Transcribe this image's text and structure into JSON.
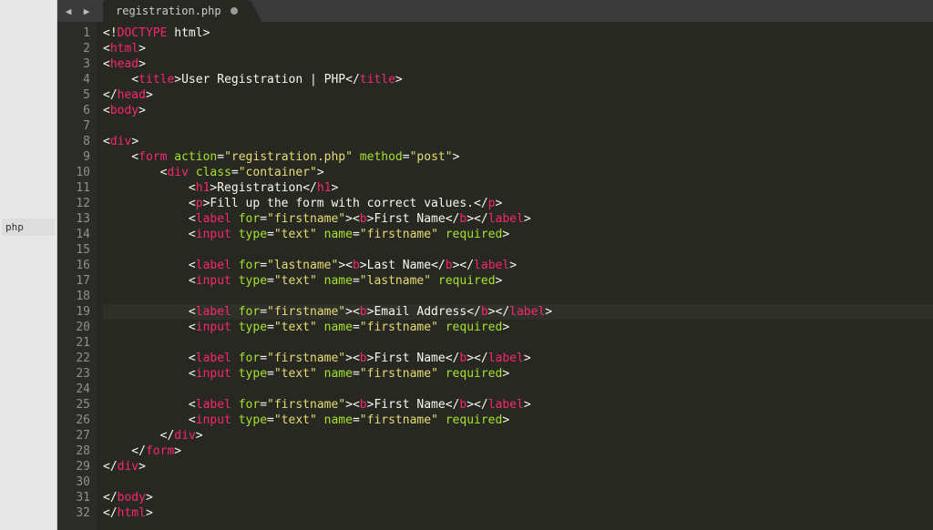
{
  "sidebar": {
    "file_label": "php"
  },
  "titlebar": {
    "back_icon": "◀",
    "forward_icon": "▶"
  },
  "tab": {
    "filename": "registration.php",
    "dirty": true
  },
  "gutter": {
    "start": 1,
    "end": 32
  },
  "code": {
    "lines": [
      [
        [
          "p",
          "<!"
        ],
        [
          "doctype",
          "DOCTYPE"
        ],
        [
          "p",
          " html>"
        ]
      ],
      [
        [
          "p",
          "<"
        ],
        [
          "tag",
          "html"
        ],
        [
          "p",
          ">"
        ]
      ],
      [
        [
          "p",
          "<"
        ],
        [
          "tag",
          "head"
        ],
        [
          "p",
          ">"
        ]
      ],
      [
        [
          "p",
          "    <"
        ],
        [
          "tag",
          "title"
        ],
        [
          "p",
          ">"
        ],
        [
          "txt",
          "User Registration | PHP"
        ],
        [
          "p",
          "</"
        ],
        [
          "tag",
          "title"
        ],
        [
          "p",
          ">"
        ]
      ],
      [
        [
          "p",
          "</"
        ],
        [
          "tag",
          "head"
        ],
        [
          "p",
          ">"
        ]
      ],
      [
        [
          "p",
          "<"
        ],
        [
          "tag",
          "body"
        ],
        [
          "p",
          ">"
        ]
      ],
      [],
      [
        [
          "p",
          "<"
        ],
        [
          "tag",
          "div"
        ],
        [
          "p",
          ">"
        ]
      ],
      [
        [
          "p",
          "    <"
        ],
        [
          "tag",
          "form"
        ],
        [
          "p",
          " "
        ],
        [
          "attr",
          "action"
        ],
        [
          "p",
          "="
        ],
        [
          "str",
          "\"registration.php\""
        ],
        [
          "p",
          " "
        ],
        [
          "attr",
          "method"
        ],
        [
          "p",
          "="
        ],
        [
          "str",
          "\"post\""
        ],
        [
          "p",
          ">"
        ]
      ],
      [
        [
          "p",
          "        <"
        ],
        [
          "tag",
          "div"
        ],
        [
          "p",
          " "
        ],
        [
          "attr",
          "class"
        ],
        [
          "p",
          "="
        ],
        [
          "str",
          "\"container\""
        ],
        [
          "p",
          ">"
        ]
      ],
      [
        [
          "p",
          "            <"
        ],
        [
          "tag",
          "h1"
        ],
        [
          "p",
          ">"
        ],
        [
          "txt",
          "Registration"
        ],
        [
          "p",
          "</"
        ],
        [
          "tag",
          "h1"
        ],
        [
          "p",
          ">"
        ]
      ],
      [
        [
          "p",
          "            <"
        ],
        [
          "tag",
          "p"
        ],
        [
          "p",
          ">"
        ],
        [
          "txt",
          "Fill up the form with correct values."
        ],
        [
          "p",
          "</"
        ],
        [
          "tag",
          "p"
        ],
        [
          "p",
          ">"
        ]
      ],
      [
        [
          "p",
          "            <"
        ],
        [
          "tag",
          "label"
        ],
        [
          "p",
          " "
        ],
        [
          "attr",
          "for"
        ],
        [
          "p",
          "="
        ],
        [
          "str",
          "\"firstname\""
        ],
        [
          "p",
          "><"
        ],
        [
          "tag",
          "b"
        ],
        [
          "p",
          ">"
        ],
        [
          "txt",
          "First Name"
        ],
        [
          "p",
          "</"
        ],
        [
          "tag",
          "b"
        ],
        [
          "p",
          "></"
        ],
        [
          "tag",
          "label"
        ],
        [
          "p",
          ">"
        ]
      ],
      [
        [
          "p",
          "            <"
        ],
        [
          "tag",
          "input"
        ],
        [
          "p",
          " "
        ],
        [
          "attr",
          "type"
        ],
        [
          "p",
          "="
        ],
        [
          "str",
          "\"text\""
        ],
        [
          "p",
          " "
        ],
        [
          "attr",
          "name"
        ],
        [
          "p",
          "="
        ],
        [
          "str",
          "\"firstname\""
        ],
        [
          "p",
          " "
        ],
        [
          "attr",
          "required"
        ],
        [
          "p",
          ">"
        ]
      ],
      [],
      [
        [
          "p",
          "            <"
        ],
        [
          "tag",
          "label"
        ],
        [
          "p",
          " "
        ],
        [
          "attr",
          "for"
        ],
        [
          "p",
          "="
        ],
        [
          "str",
          "\"lastname\""
        ],
        [
          "p",
          "><"
        ],
        [
          "tag",
          "b"
        ],
        [
          "p",
          ">"
        ],
        [
          "txt",
          "Last Name"
        ],
        [
          "p",
          "</"
        ],
        [
          "tag",
          "b"
        ],
        [
          "p",
          "></"
        ],
        [
          "tag",
          "label"
        ],
        [
          "p",
          ">"
        ]
      ],
      [
        [
          "p",
          "            <"
        ],
        [
          "tag",
          "input"
        ],
        [
          "p",
          " "
        ],
        [
          "attr",
          "type"
        ],
        [
          "p",
          "="
        ],
        [
          "str",
          "\"text\""
        ],
        [
          "p",
          " "
        ],
        [
          "attr",
          "name"
        ],
        [
          "p",
          "="
        ],
        [
          "str",
          "\"lastname\""
        ],
        [
          "p",
          " "
        ],
        [
          "attr",
          "required"
        ],
        [
          "p",
          ">"
        ]
      ],
      [],
      [
        [
          "p",
          "            <"
        ],
        [
          "tag",
          "label"
        ],
        [
          "p",
          " "
        ],
        [
          "attr",
          "for"
        ],
        [
          "p",
          "="
        ],
        [
          "str",
          "\"firstname\""
        ],
        [
          "p",
          "><"
        ],
        [
          "tag",
          "b"
        ],
        [
          "p",
          ">"
        ],
        [
          "txt",
          "Email Address"
        ],
        [
          "p",
          "</"
        ],
        [
          "tag",
          "b"
        ],
        [
          "p",
          "></"
        ],
        [
          "tag",
          "label"
        ],
        [
          "p",
          ">"
        ]
      ],
      [
        [
          "p",
          "            <"
        ],
        [
          "tag",
          "input"
        ],
        [
          "p",
          " "
        ],
        [
          "attr",
          "type"
        ],
        [
          "p",
          "="
        ],
        [
          "str",
          "\"text\""
        ],
        [
          "p",
          " "
        ],
        [
          "attr",
          "name"
        ],
        [
          "p",
          "="
        ],
        [
          "str",
          "\"firstname\""
        ],
        [
          "p",
          " "
        ],
        [
          "attr",
          "required"
        ],
        [
          "p",
          ">"
        ]
      ],
      [],
      [
        [
          "p",
          "            <"
        ],
        [
          "tag",
          "label"
        ],
        [
          "p",
          " "
        ],
        [
          "attr",
          "for"
        ],
        [
          "p",
          "="
        ],
        [
          "str",
          "\"firstname\""
        ],
        [
          "p",
          "><"
        ],
        [
          "tag",
          "b"
        ],
        [
          "p",
          ">"
        ],
        [
          "txt",
          "First Name"
        ],
        [
          "p",
          "</"
        ],
        [
          "tag",
          "b"
        ],
        [
          "p",
          "></"
        ],
        [
          "tag",
          "label"
        ],
        [
          "p",
          ">"
        ]
      ],
      [
        [
          "p",
          "            <"
        ],
        [
          "tag",
          "input"
        ],
        [
          "p",
          " "
        ],
        [
          "attr",
          "type"
        ],
        [
          "p",
          "="
        ],
        [
          "str",
          "\"text\""
        ],
        [
          "p",
          " "
        ],
        [
          "attr",
          "name"
        ],
        [
          "p",
          "="
        ],
        [
          "str",
          "\"firstname\""
        ],
        [
          "p",
          " "
        ],
        [
          "attr",
          "required"
        ],
        [
          "p",
          ">"
        ]
      ],
      [],
      [
        [
          "p",
          "            <"
        ],
        [
          "tag",
          "label"
        ],
        [
          "p",
          " "
        ],
        [
          "attr",
          "for"
        ],
        [
          "p",
          "="
        ],
        [
          "str",
          "\"firstname\""
        ],
        [
          "p",
          "><"
        ],
        [
          "tag",
          "b"
        ],
        [
          "p",
          ">"
        ],
        [
          "txt",
          "First Name"
        ],
        [
          "p",
          "</"
        ],
        [
          "tag",
          "b"
        ],
        [
          "p",
          "></"
        ],
        [
          "tag",
          "label"
        ],
        [
          "p",
          ">"
        ]
      ],
      [
        [
          "p",
          "            <"
        ],
        [
          "tag",
          "input"
        ],
        [
          "p",
          " "
        ],
        [
          "attr",
          "type"
        ],
        [
          "p",
          "="
        ],
        [
          "str",
          "\"text\""
        ],
        [
          "p",
          " "
        ],
        [
          "attr",
          "name"
        ],
        [
          "p",
          "="
        ],
        [
          "str",
          "\"firstname\""
        ],
        [
          "p",
          " "
        ],
        [
          "attr",
          "required"
        ],
        [
          "p",
          ">"
        ]
      ],
      [
        [
          "p",
          "        </"
        ],
        [
          "tag",
          "div"
        ],
        [
          "p",
          ">"
        ]
      ],
      [
        [
          "p",
          "    </"
        ],
        [
          "tag",
          "form"
        ],
        [
          "p",
          ">"
        ]
      ],
      [
        [
          "p",
          "</"
        ],
        [
          "tag",
          "div"
        ],
        [
          "p",
          ">"
        ]
      ],
      [],
      [
        [
          "p",
          "</"
        ],
        [
          "tag",
          "body"
        ],
        [
          "p",
          ">"
        ]
      ],
      [
        [
          "p",
          "</"
        ],
        [
          "tag",
          "html"
        ],
        [
          "p",
          ">"
        ]
      ]
    ],
    "highlighted_line": 19
  }
}
